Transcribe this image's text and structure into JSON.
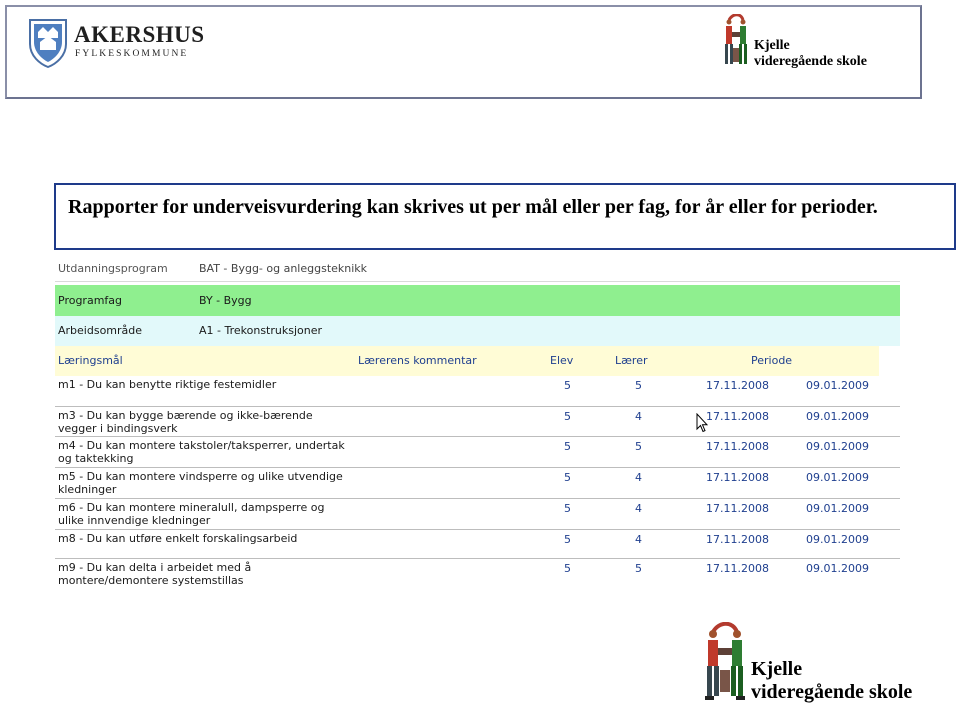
{
  "header": {
    "org_name": "AKERSHUS",
    "org_subtitle": "FYLKESKOMMUNE",
    "school_line1": "Kjelle",
    "school_line2": "videregående skole"
  },
  "title": "Rapporter for underveisvurdering kan skrives ut per mål eller per fag, for år eller for perioder.",
  "report": {
    "utdanningsprogram_label": "Utdanningsprogram",
    "utdanningsprogram_value": "BAT - Bygg- og anleggsteknikk",
    "programfag_label": "Programfag",
    "programfag_value": "BY - Bygg",
    "arbeidsomrade_label": "Arbeidsområde",
    "arbeidsomrade_value": "A1 - Trekonstruksjoner",
    "columns": {
      "goal": "Læringsmål",
      "comment": "Lærerens kommentar",
      "student": "Elev",
      "teacher": "Lærer",
      "period": "Periode"
    },
    "rows": [
      {
        "goal": "m1 - Du kan benytte riktige festemidler",
        "elev": "5",
        "laerer": "5",
        "from": "17.11.2008",
        "to": "09.01.2009"
      },
      {
        "goal": "m3 - Du kan bygge bærende og ikke-bærende vegger i bindingsverk",
        "elev": "5",
        "laerer": "4",
        "from": "17.11.2008",
        "to": "09.01.2009"
      },
      {
        "goal": "m4 - Du kan montere takstoler/taksperrer, undertak og taktekking",
        "elev": "5",
        "laerer": "5",
        "from": "17.11.2008",
        "to": "09.01.2009"
      },
      {
        "goal": "m5 - Du kan montere vindsperre og ulike utvendige kledninger",
        "elev": "5",
        "laerer": "4",
        "from": "17.11.2008",
        "to": "09.01.2009"
      },
      {
        "goal": "m6 - Du kan montere mineralull, dampsperre og ulike innvendige kledninger",
        "elev": "5",
        "laerer": "4",
        "from": "17.11.2008",
        "to": "09.01.2009"
      },
      {
        "goal": "m8 - Du kan utføre enkelt forskalingsarbeid",
        "elev": "5",
        "laerer": "4",
        "from": "17.11.2008",
        "to": "09.01.2009"
      },
      {
        "goal": "m9 - Du kan delta i arbeidet med å montere/demontere systemstillas",
        "elev": "5",
        "laerer": "5",
        "from": "17.11.2008",
        "to": "09.01.2009"
      }
    ]
  },
  "colors": {
    "programfag_bg": "#8fef8f",
    "arbeidsomrade_bg": "#e2f9fa",
    "header_row_bg": "#fffcd6",
    "link_blue": "#1f3f8f",
    "title_border": "#1e3a8a"
  }
}
